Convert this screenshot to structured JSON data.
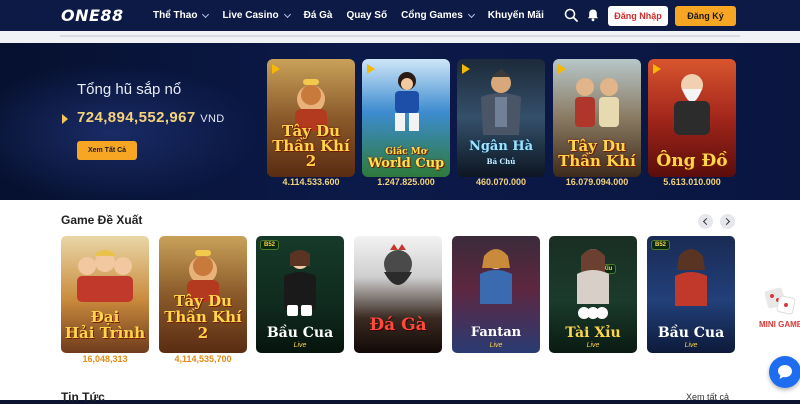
{
  "brand": {
    "logo_text": "ONE88"
  },
  "nav": {
    "items": [
      {
        "label": "Thể Thao",
        "dropdown": true
      },
      {
        "label": "Live Casino",
        "dropdown": true
      },
      {
        "label": "Đá Gà",
        "dropdown": false
      },
      {
        "label": "Quay Số",
        "dropdown": false
      },
      {
        "label": "Cổng Games",
        "dropdown": true
      },
      {
        "label": "Khuyến Mãi",
        "dropdown": false
      }
    ],
    "login_label": "Đăng Nhập",
    "register_label": "Đăng Ký",
    "icons": [
      "search-icon",
      "bell-icon"
    ]
  },
  "jackpot": {
    "title": "Tổng hũ sắp nổ",
    "amount": "724,894,552,967",
    "currency": "VND",
    "view_all_label": "Xem Tất Cả",
    "games": [
      {
        "title_line1": "Tây Du",
        "title_line2": "Thần Khí 2",
        "value": "4.114.533.600"
      },
      {
        "title_line1": "Giấc Mơ",
        "title_line2": "World Cup",
        "value": "1.247.825.000"
      },
      {
        "title_line1": "Ngân Hà",
        "title_line2": "Bá Chủ",
        "value": "460.070.000"
      },
      {
        "title_line1": "Tây Du",
        "title_line2": "Thần Khí",
        "value": "16.079.094.000"
      },
      {
        "title_line1": "Ông Đồ",
        "title_line2": "",
        "value": "5.613.010.000"
      }
    ]
  },
  "recommended": {
    "title": "Game Đề Xuất",
    "games": [
      {
        "title_line1": "Đại",
        "title_line2": "Hải Trình",
        "sub": "",
        "value": "16,048,313"
      },
      {
        "title_line1": "Tây Du",
        "title_line2": "Thần Khí 2",
        "sub": "",
        "value": "4,114,535,700"
      },
      {
        "title_line1": "Bầu Cua",
        "title_line2": "",
        "sub": "Live",
        "value": ""
      },
      {
        "title_line1": "Đá Gà",
        "title_line2": "",
        "sub": "",
        "value": ""
      },
      {
        "title_line1": "Fantan",
        "title_line2": "",
        "sub": "Live",
        "value": ""
      },
      {
        "title_line1": "Tài Xỉu",
        "title_line2": "",
        "sub": "Live",
        "value": ""
      },
      {
        "title_line1": "Bầu Cua",
        "title_line2": "",
        "sub": "Live",
        "value": ""
      }
    ],
    "badge_label": "Xỉu"
  },
  "news": {
    "title": "Tin Tức",
    "more_label": "Xem tất cả"
  },
  "floating": {
    "mini_games_label": "MINI GAMES"
  },
  "colors": {
    "nav_bg": "#0d1a45",
    "accent": "#f6a623",
    "gold": "#f6d37a"
  }
}
